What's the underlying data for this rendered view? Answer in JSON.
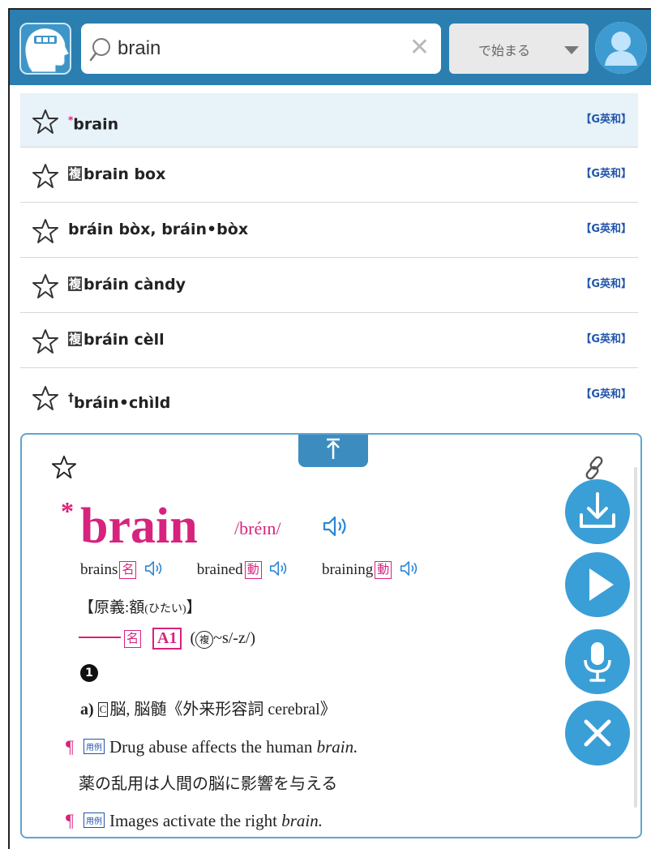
{
  "header": {
    "search_value": "brain",
    "mode_label": "で始まる"
  },
  "results": [
    {
      "mark": "*",
      "box": "",
      "word": "brain",
      "source": "【G英和】",
      "selected": true
    },
    {
      "mark": "",
      "box": "複",
      "word": "brain box",
      "source": "【G英和】"
    },
    {
      "mark": "",
      "box": "",
      "word": "bráin bòx, bráin•bòx",
      "source": "【G英和】"
    },
    {
      "mark": "",
      "box": "複",
      "word": "bráin càndy",
      "source": "【G英和】"
    },
    {
      "mark": "",
      "box": "複",
      "word": "bráin cèll",
      "source": "【G英和】"
    },
    {
      "mark": "†",
      "box": "",
      "word": "bráin•chìld",
      "source": "【G英和】"
    }
  ],
  "entry": {
    "star": "*",
    "headword": "brain",
    "pronunciation": "/bréɪn/",
    "forms": [
      {
        "word": "brains",
        "pos": "名"
      },
      {
        "word": "brained",
        "pos": "動"
      },
      {
        "word": "braining",
        "pos": "動"
      }
    ],
    "origin_label": "【原義:額",
    "origin_reading": "(ひたい)",
    "origin_close": "】",
    "pos": "名",
    "level": "A1",
    "plural_open": "(",
    "plural_mark": "複",
    "plural_text": "~s/-z/)",
    "sense_number": "1",
    "definition_letter": "a)",
    "definition_countable": "C",
    "definition_text": "脳, 脳髄《外来形容詞 cerebral》",
    "examples": [
      {
        "tag": "用例",
        "en_before": "Drug abuse affects the human ",
        "en_italic": "brain.",
        "ja": "薬の乱用は人間の脳に影響を与える"
      },
      {
        "tag": "用例",
        "en_before": "Images activate the right ",
        "en_italic": "brain.",
        "ja": ""
      }
    ]
  },
  "colors": {
    "header_bg": "#2a7fb0",
    "accent_magenta": "#d6237e",
    "fab_blue": "#3a9fd6",
    "source_blue": "#2255aa"
  }
}
